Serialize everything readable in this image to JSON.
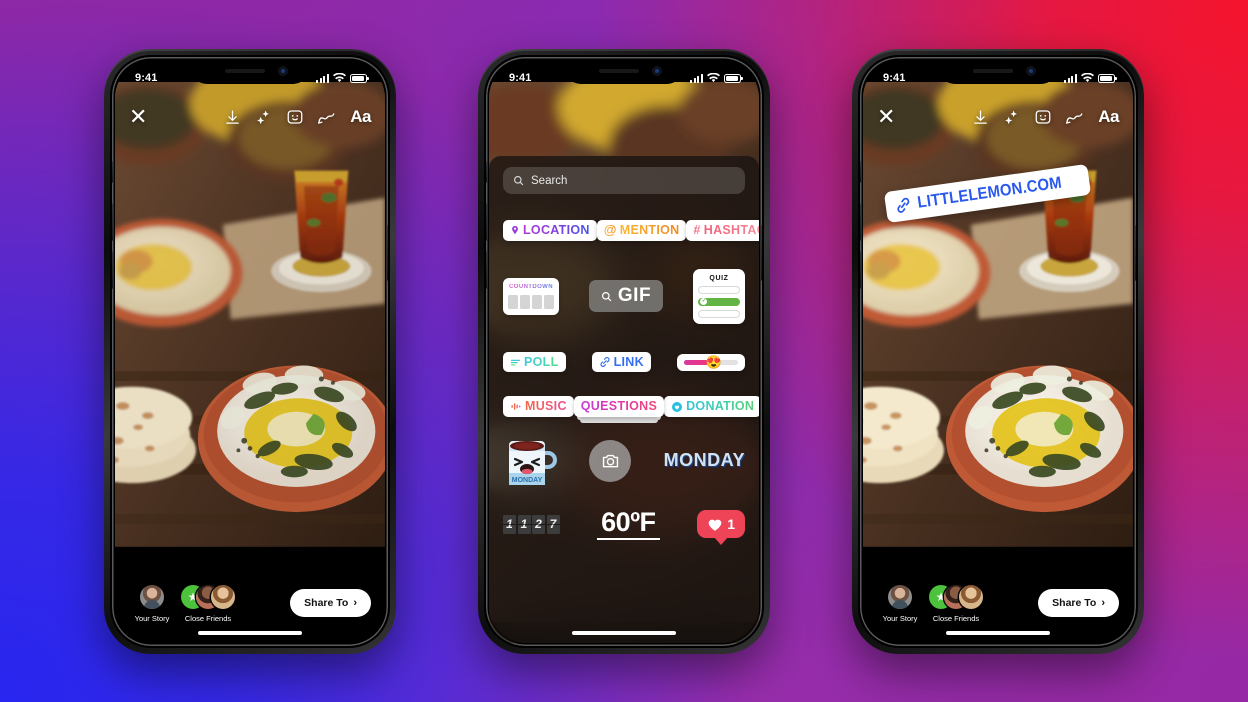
{
  "background": {
    "gradient_colors": [
      "#9b2aa4",
      "#f5142d",
      "#2826f0",
      "#932aa5"
    ]
  },
  "phones": [
    {
      "id": "phone-story-editor",
      "status_bar": {
        "time": "9:41",
        "signal": "cellular-bars-icon",
        "wifi": "wifi-icon",
        "battery": "battery-icon"
      },
      "toolbar": {
        "close_label": "✕",
        "items": [
          {
            "name": "save-icon",
            "label": "download"
          },
          {
            "name": "sparkles-icon",
            "label": "effects"
          },
          {
            "name": "sticker-icon",
            "label": "stickers"
          },
          {
            "name": "draw-icon",
            "label": "draw"
          },
          {
            "name": "text-icon",
            "label": "Aa"
          }
        ]
      },
      "bottom": {
        "your_story_label": "Your Story",
        "close_friends_label": "Close Friends",
        "share_label": "Share To",
        "share_chevron": "›"
      }
    },
    {
      "id": "phone-sticker-tray",
      "status_bar": {
        "time": "9:41"
      },
      "tray": {
        "search": {
          "placeholder": "Search",
          "value": ""
        },
        "row_pills": [
          {
            "name": "location-sticker",
            "label": "LOCATION",
            "icon": "location-pin-icon",
            "gradient": "g-location"
          },
          {
            "name": "mention-sticker",
            "label": "MENTION",
            "icon": "at-icon",
            "gradient": "g-mention"
          },
          {
            "name": "hashtag-sticker",
            "label": "HASHTAG",
            "icon": "hash-icon",
            "gradient": "g-hashtag"
          }
        ],
        "countdown": {
          "title": "COUNTDOWN"
        },
        "gif": {
          "label": "GIF",
          "icon": "search-icon"
        },
        "quiz": {
          "title": "QUIZ"
        },
        "poll": {
          "label": "POLL",
          "icon": "poll-bars-icon",
          "gradient": "g-poll"
        },
        "link": {
          "label": "LINK",
          "icon": "chain-link-icon",
          "gradient": "g-link"
        },
        "slider": {
          "emoji": "😍"
        },
        "music": {
          "label": "MUSIC",
          "icon": "equalizer-icon",
          "gradient": "g-music"
        },
        "questions": {
          "label": "QUESTIONS",
          "gradient": "g-questions"
        },
        "donation": {
          "label": "DONATION",
          "icon": "heart-circle-icon",
          "gradient": "g-donation"
        },
        "mug": {
          "label": "MONDAY"
        },
        "camera": {
          "icon": "camera-icon"
        },
        "day_text": {
          "label": "MONDAY"
        },
        "time_flip": {
          "digits": [
            "1",
            "1",
            "2",
            "7"
          ]
        },
        "temperature": {
          "label": "60ºF"
        },
        "like_count": {
          "count": "1",
          "icon": "heart-icon"
        }
      }
    },
    {
      "id": "phone-story-with-link",
      "status_bar": {
        "time": "9:41"
      },
      "toolbar": {
        "close_label": "✕",
        "items": [
          {
            "name": "save-icon",
            "label": "download"
          },
          {
            "name": "sparkles-icon",
            "label": "effects"
          },
          {
            "name": "sticker-icon",
            "label": "stickers"
          },
          {
            "name": "draw-icon",
            "label": "draw"
          },
          {
            "name": "text-icon",
            "label": "Aa"
          }
        ]
      },
      "link_sticker": {
        "label": "LITTLELEMON.COM",
        "icon": "chain-link-icon",
        "color": "#2a58ef"
      },
      "bottom": {
        "your_story_label": "Your Story",
        "close_friends_label": "Close Friends",
        "share_label": "Share To",
        "share_chevron": "›"
      }
    }
  ]
}
